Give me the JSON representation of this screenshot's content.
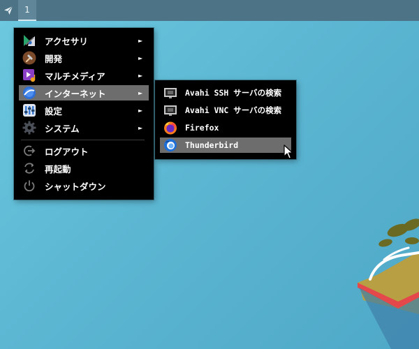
{
  "panel": {
    "launcher_icon": "paper-plane-icon",
    "workspace_label": "1"
  },
  "main_menu": {
    "items": [
      {
        "label": "アクセサリ",
        "icon": "accessories-icon",
        "has_submenu": true
      },
      {
        "label": "開発",
        "icon": "hammer-icon",
        "has_submenu": true
      },
      {
        "label": "マルチメディア",
        "icon": "multimedia-icon",
        "has_submenu": true
      },
      {
        "label": "インターネット",
        "icon": "internet-icon",
        "has_submenu": true,
        "highlighted": true
      },
      {
        "label": "設定",
        "icon": "settings-icon",
        "has_submenu": true
      },
      {
        "label": "システム",
        "icon": "gear-icon",
        "has_submenu": true
      },
      {
        "label": "ログアウト",
        "icon": "logout-icon"
      },
      {
        "label": "再起動",
        "icon": "restart-icon"
      },
      {
        "label": "シャットダウン",
        "icon": "power-icon"
      }
    ],
    "arrow_glyph": "►"
  },
  "internet_submenu": {
    "items": [
      {
        "label": "Avahi SSH サーバの検索",
        "icon": "network-monitor-icon"
      },
      {
        "label": "Avahi VNC サーバの検索",
        "icon": "network-monitor-icon"
      },
      {
        "label": "Firefox",
        "icon": "firefox-icon"
      },
      {
        "label": "Thunderbird",
        "icon": "thunderbird-icon",
        "highlighted": true
      }
    ]
  },
  "colors": {
    "menu_bg": "#000000",
    "highlight": "#6d6d6d",
    "panel": "#4d7486",
    "desktop": "#5cb7d3"
  }
}
